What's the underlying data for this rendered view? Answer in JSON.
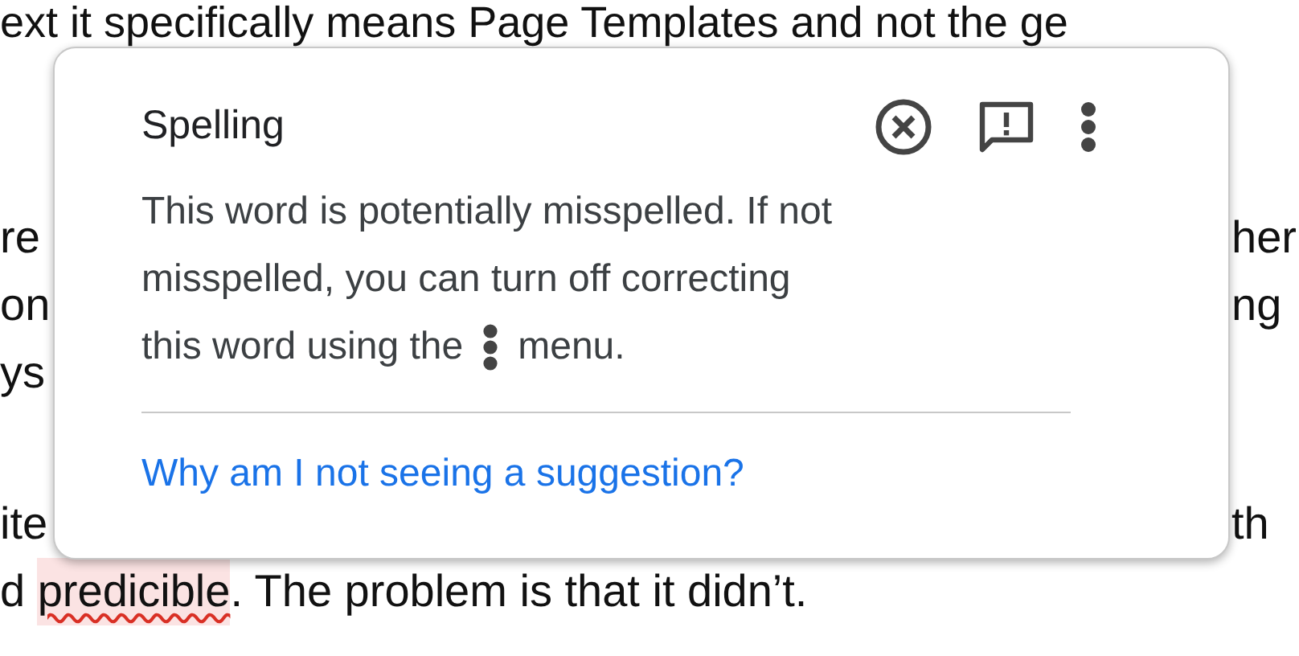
{
  "document": {
    "top_line": "ext it specifically means Page Templates and not the ge",
    "side_lines": [
      {
        "left": "re",
        "right": "her"
      },
      {
        "left": "on",
        "right": "ng"
      },
      {
        "left": "ys"
      },
      {
        "left": "ite",
        "right": "th"
      }
    ],
    "last_line": {
      "before": "d ",
      "flagged": "predicible",
      "after": ". The problem is that it didn’t."
    }
  },
  "popup": {
    "title": "Spelling",
    "message_lines": [
      "This word is potentially misspelled. If not",
      "misspelled, you can turn off correcting",
      "this word using the"
    ],
    "message_after": "menu.",
    "link": "Why am I not seeing a suggestion?"
  }
}
